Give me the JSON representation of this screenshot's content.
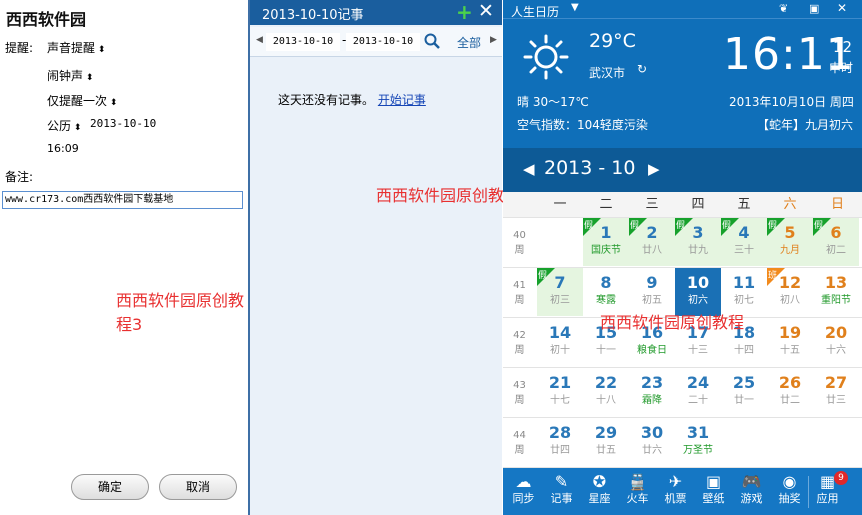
{
  "left": {
    "title": "西西软件园",
    "remind_label": "提醒:",
    "remind_type": "声音提醒",
    "sound": "闹钟声",
    "repeat": "仅提醒一次",
    "calendar_type": "公历",
    "date": "2013-10-10",
    "time": "16:09",
    "note_label": "备注:",
    "note_value": "www.cr173.com西西软件园下载基地",
    "ok_label": "确定",
    "cancel_label": "取消",
    "watermark": "西西软件园原创教程3"
  },
  "mid": {
    "title": "2013-10-10记事",
    "plus_icon": "+",
    "close_icon": "✕",
    "from_date": "2013-10-10",
    "dash": "-",
    "to_date": "2013-10-10",
    "all_label": "全部",
    "empty_text": "这天还没有记事。",
    "start_link": "开始记事",
    "watermark": "西西软件园原创教程"
  },
  "cal": {
    "app_title": "人生日历",
    "temperature": "29°C",
    "city": "武汉市",
    "weather": "晴 30～17℃",
    "aqi": "空气指数：104轻度污染",
    "time_hm": "16:11",
    "time_sec": "12",
    "time_zone": "申时",
    "date_line": "2013年10月10日 周四",
    "lunar_line": "【蛇年】九月初六",
    "month_title": "2013 - 10",
    "weekdays": [
      "一",
      "二",
      "三",
      "四",
      "五",
      "六",
      "日"
    ],
    "week_label": "周",
    "weeks": [
      {
        "num": "40",
        "days": [
          {
            "d": "",
            "s": ""
          },
          {
            "d": "1",
            "s": "国庆节",
            "type": "holiday",
            "tag": "假"
          },
          {
            "d": "2",
            "s": "廿八",
            "type": "holiday",
            "tag": "假"
          },
          {
            "d": "3",
            "s": "廿九",
            "type": "holiday",
            "tag": "假"
          },
          {
            "d": "4",
            "s": "三十",
            "type": "holiday",
            "tag": "假"
          },
          {
            "d": "5",
            "s": "九月",
            "type": "holiday",
            "tag": "假"
          },
          {
            "d": "6",
            "s": "初二",
            "type": "holiday",
            "tag": "假"
          }
        ]
      },
      {
        "num": "41",
        "days": [
          {
            "d": "7",
            "s": "初三",
            "type": "holiday",
            "tag": "假"
          },
          {
            "d": "8",
            "s": "寒露"
          },
          {
            "d": "9",
            "s": "初五"
          },
          {
            "d": "10",
            "s": "初六",
            "type": "today"
          },
          {
            "d": "11",
            "s": "初七"
          },
          {
            "d": "12",
            "s": "初八",
            "tag": "班"
          },
          {
            "d": "13",
            "s": "重阳节"
          }
        ]
      },
      {
        "num": "42",
        "days": [
          {
            "d": "14",
            "s": "初十"
          },
          {
            "d": "15",
            "s": "十一"
          },
          {
            "d": "16",
            "s": "粮食日"
          },
          {
            "d": "17",
            "s": "十三"
          },
          {
            "d": "18",
            "s": "十四"
          },
          {
            "d": "19",
            "s": "十五"
          },
          {
            "d": "20",
            "s": "十六"
          }
        ]
      },
      {
        "num": "43",
        "days": [
          {
            "d": "21",
            "s": "十七"
          },
          {
            "d": "22",
            "s": "十八"
          },
          {
            "d": "23",
            "s": "霜降"
          },
          {
            "d": "24",
            "s": "二十"
          },
          {
            "d": "25",
            "s": "廿一"
          },
          {
            "d": "26",
            "s": "廿二"
          },
          {
            "d": "27",
            "s": "廿三"
          }
        ]
      },
      {
        "num": "44",
        "days": [
          {
            "d": "28",
            "s": "廿四"
          },
          {
            "d": "29",
            "s": "廿五"
          },
          {
            "d": "30",
            "s": "廿六"
          },
          {
            "d": "31",
            "s": "万圣节"
          },
          {
            "d": "",
            "s": ""
          },
          {
            "d": "",
            "s": ""
          },
          {
            "d": "",
            "s": ""
          }
        ]
      }
    ],
    "bottom_items": [
      {
        "icon": "cloud-sync-icon",
        "glyph": "☁",
        "label": "同步"
      },
      {
        "icon": "notepad-icon",
        "glyph": "✎",
        "label": "记事"
      },
      {
        "icon": "star-sign-icon",
        "glyph": "✪",
        "label": "星座"
      },
      {
        "icon": "train-icon",
        "glyph": "🚆",
        "label": "火车"
      },
      {
        "icon": "airplane-icon",
        "glyph": "✈",
        "label": "机票"
      },
      {
        "icon": "wallpaper-icon",
        "glyph": "▣",
        "label": "壁纸"
      },
      {
        "icon": "gamepad-icon",
        "glyph": "🎮",
        "label": "游戏"
      },
      {
        "icon": "weibo-icon",
        "glyph": "◉",
        "label": "抽奖"
      },
      {
        "icon": "apps-grid-icon",
        "glyph": "▦",
        "label": "应用"
      }
    ],
    "apps_badge": "9",
    "watermark_top": "西西软件园原创教程",
    "colors": {
      "accent": "#0f6fb9",
      "holiday_green": "#17a12c",
      "weekend_orange": "#e0801c",
      "date_blue": "#2a78b8",
      "festival_green": "#229a2c"
    }
  }
}
